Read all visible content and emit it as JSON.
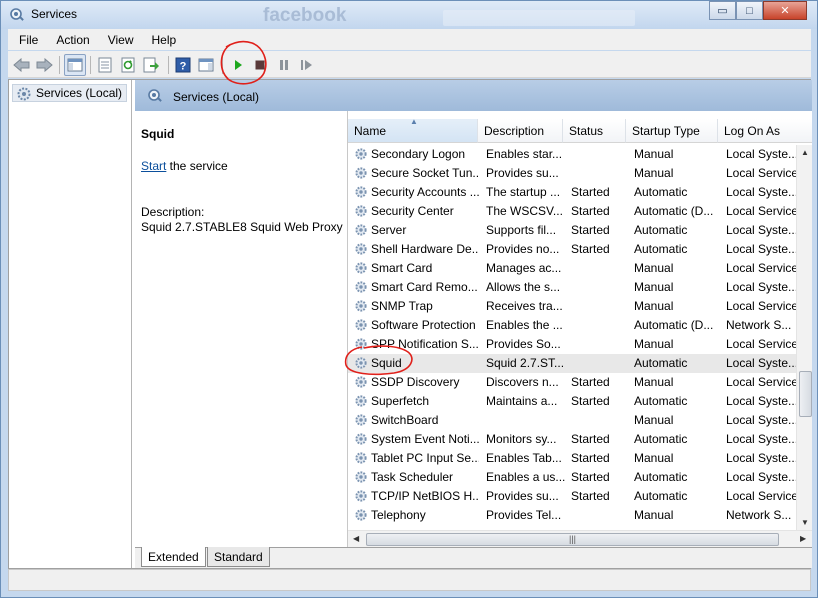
{
  "window": {
    "title": "Services",
    "icon": "services-gear-icon"
  },
  "background": {
    "browser_text": "facebook"
  },
  "window_controls": {
    "minimize": "▭",
    "maximize": "□",
    "close": "✕"
  },
  "menu": [
    "File",
    "Action",
    "View",
    "Help"
  ],
  "toolbar": {
    "icons": [
      "back-arrow-icon",
      "forward-arrow-icon",
      "show-hide-console-tree-icon",
      "properties-icon",
      "refresh-icon",
      "export-list-icon",
      "help-icon",
      "show-hide-action-pane-icon",
      "start-service-icon",
      "stop-service-icon",
      "pause-service-icon",
      "resume-service-icon"
    ]
  },
  "tree": {
    "item": "Services (Local)"
  },
  "header": {
    "title": "Services (Local)"
  },
  "details": {
    "service_name": "Squid",
    "start_link": "Start",
    "start_suffix": " the service",
    "description_label": "Description:",
    "description": "Squid 2.7.STABLE8 Squid Web Proxy"
  },
  "columns": [
    "Name",
    "Description",
    "Status",
    "Startup Type",
    "Log On As"
  ],
  "rows": [
    {
      "name": "Secondary Logon",
      "desc": "Enables star...",
      "status": "",
      "startup": "Manual",
      "logon": "Local Syste..."
    },
    {
      "name": "Secure Socket Tun...",
      "desc": "Provides su...",
      "status": "",
      "startup": "Manual",
      "logon": "Local Service"
    },
    {
      "name": "Security Accounts ...",
      "desc": "The startup ...",
      "status": "Started",
      "startup": "Automatic",
      "logon": "Local Syste..."
    },
    {
      "name": "Security Center",
      "desc": "The WSCSV...",
      "status": "Started",
      "startup": "Automatic (D...",
      "logon": "Local Service"
    },
    {
      "name": "Server",
      "desc": "Supports fil...",
      "status": "Started",
      "startup": "Automatic",
      "logon": "Local Syste..."
    },
    {
      "name": "Shell Hardware De...",
      "desc": "Provides no...",
      "status": "Started",
      "startup": "Automatic",
      "logon": "Local Syste..."
    },
    {
      "name": "Smart Card",
      "desc": "Manages ac...",
      "status": "",
      "startup": "Manual",
      "logon": "Local Service"
    },
    {
      "name": "Smart Card Remo...",
      "desc": "Allows the s...",
      "status": "",
      "startup": "Manual",
      "logon": "Local Syste..."
    },
    {
      "name": "SNMP Trap",
      "desc": "Receives tra...",
      "status": "",
      "startup": "Manual",
      "logon": "Local Service"
    },
    {
      "name": "Software Protection",
      "desc": "Enables the ...",
      "status": "",
      "startup": "Automatic (D...",
      "logon": "Network S..."
    },
    {
      "name": "SPP Notification S...",
      "desc": "Provides So...",
      "status": "",
      "startup": "Manual",
      "logon": "Local Service"
    },
    {
      "name": "Squid",
      "desc": "Squid 2.7.ST...",
      "status": "",
      "startup": "Automatic",
      "logon": "Local Syste..."
    },
    {
      "name": "SSDP Discovery",
      "desc": "Discovers n...",
      "status": "Started",
      "startup": "Manual",
      "logon": "Local Service"
    },
    {
      "name": "Superfetch",
      "desc": "Maintains a...",
      "status": "Started",
      "startup": "Automatic",
      "logon": "Local Syste..."
    },
    {
      "name": "SwitchBoard",
      "desc": "",
      "status": "",
      "startup": "Manual",
      "logon": "Local Syste..."
    },
    {
      "name": "System Event Noti...",
      "desc": "Monitors sy...",
      "status": "Started",
      "startup": "Automatic",
      "logon": "Local Syste..."
    },
    {
      "name": "Tablet PC Input Se...",
      "desc": "Enables Tab...",
      "status": "Started",
      "startup": "Manual",
      "logon": "Local Syste..."
    },
    {
      "name": "Task Scheduler",
      "desc": "Enables a us...",
      "status": "Started",
      "startup": "Automatic",
      "logon": "Local Syste..."
    },
    {
      "name": "TCP/IP NetBIOS H...",
      "desc": "Provides su...",
      "status": "Started",
      "startup": "Automatic",
      "logon": "Local Service"
    },
    {
      "name": "Telephony",
      "desc": "Provides Tel...",
      "status": "",
      "startup": "Manual",
      "logon": "Network S..."
    }
  ],
  "selected_row": 11,
  "scrollbar": {
    "thumb_grip": "|||"
  },
  "tabs": [
    "Extended",
    "Standard"
  ],
  "colors": {
    "accent": "#1e395b",
    "annotation": "#e0201a",
    "start_green": "#1ea81e"
  }
}
